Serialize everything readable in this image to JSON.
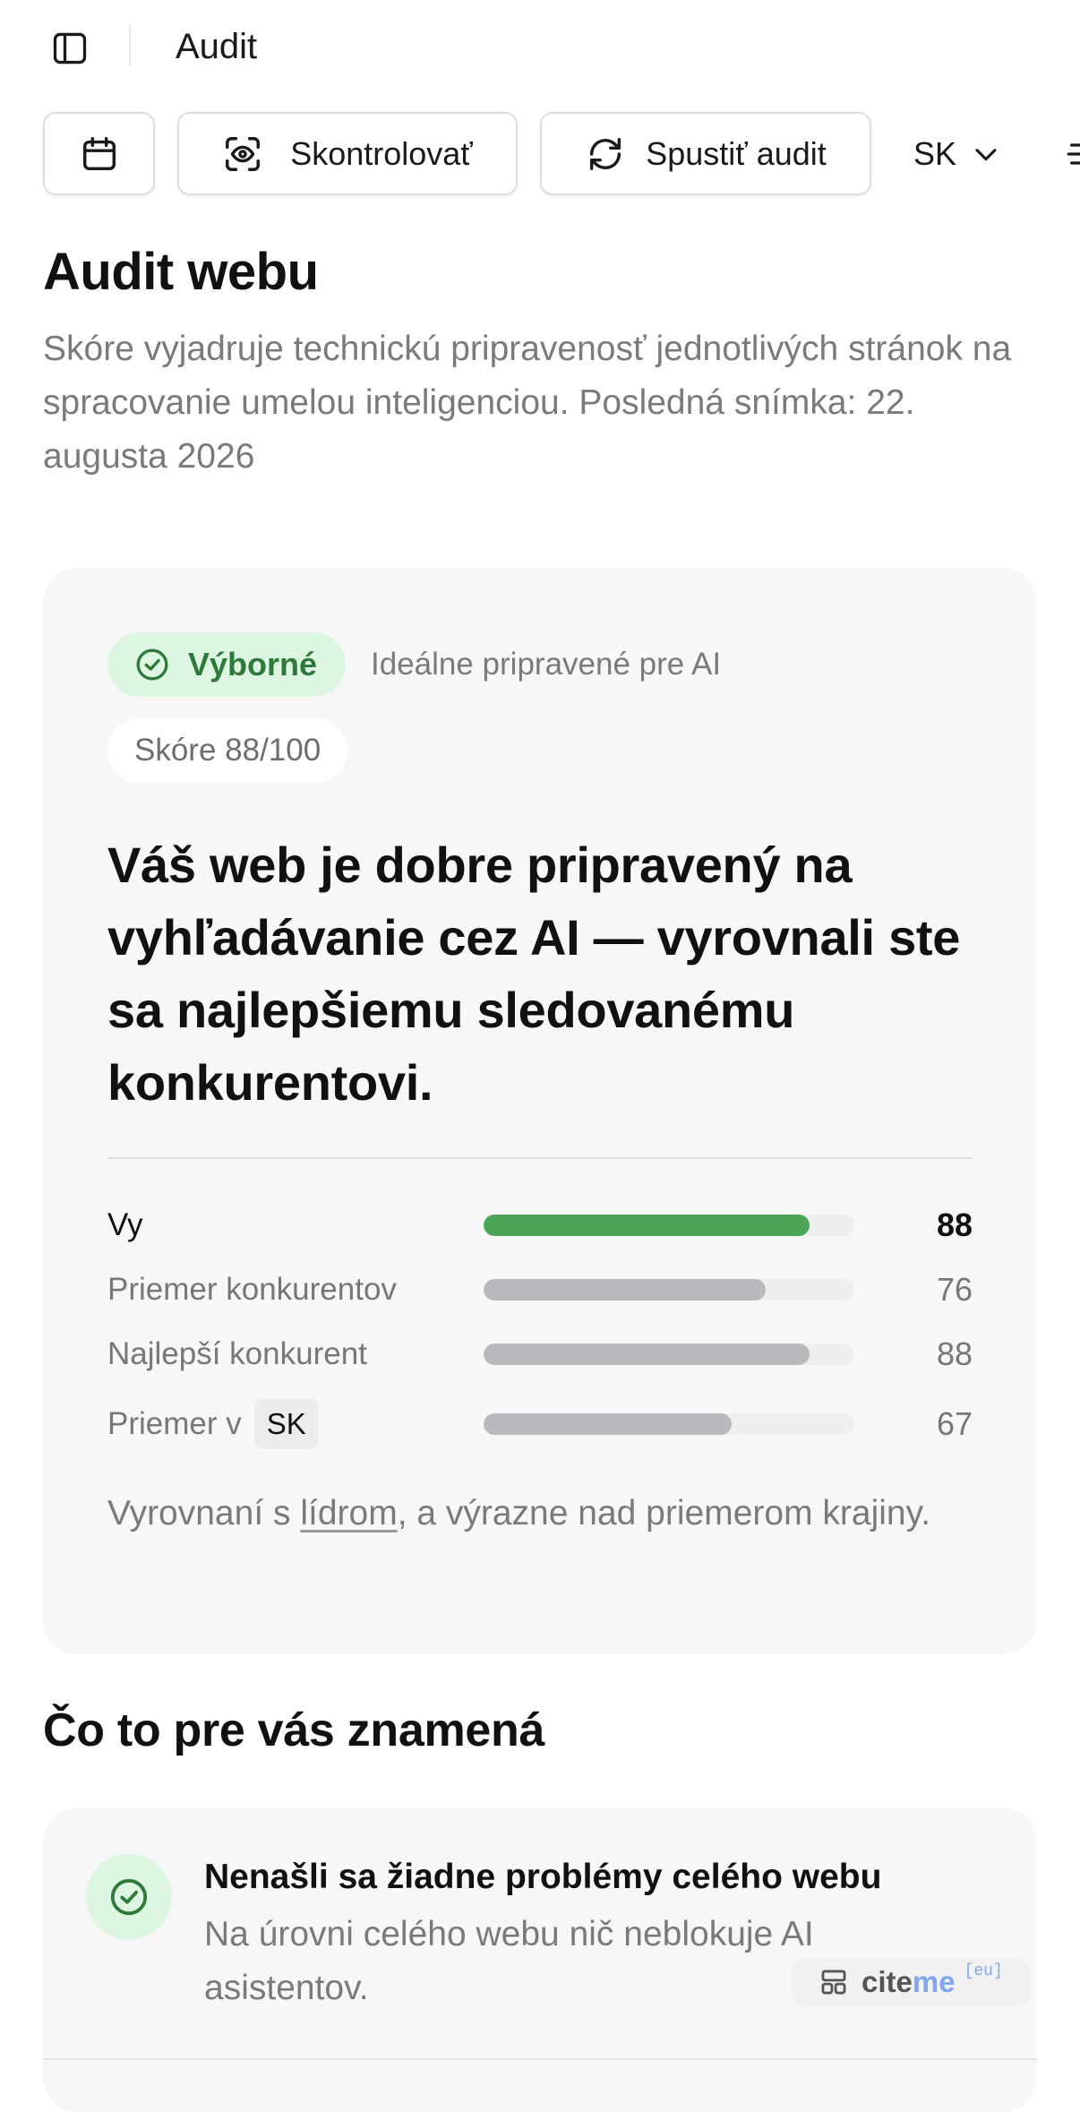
{
  "topbar": {
    "title": "Audit"
  },
  "toolbar": {
    "check_label": "Skontrolovať",
    "run_label": "Spustiť audit",
    "language": "SK"
  },
  "page": {
    "title": "Audit webu",
    "description": "Skóre vyjadruje technickú pripravenosť jednotlivých stránok na spracovanie umelou inteligenciou. Posledná snímka: 22. augusta 2026"
  },
  "score_card": {
    "status_label": "Výborné",
    "status_caption": "Ideálne pripravené pre AI",
    "score_pill": "Skóre 88/100",
    "headline": "Váš web je dobre pripravený na vyhľadávanie cez AI — vyrovnali ste sa najlepšiemu sledovanému konkurentovi.",
    "rows": [
      {
        "label": "Vy",
        "value": 88
      },
      {
        "label": "Priemer konkurentov",
        "value": 76
      },
      {
        "label": "Najlepší konkurent",
        "value": 88
      },
      {
        "label": "Priemer v",
        "chip": "SK",
        "value": 67
      }
    ],
    "summary_before": "Vyrovnaní s ",
    "summary_link": "lídrom",
    "summary_after": ", a výrazne nad priemerom krajiny."
  },
  "meaning": {
    "title": "Čo to pre vás znamená",
    "item_title": "Nenašli sa žiadne problémy celého webu",
    "item_text": "Na úrovni celého webu nič neblokuje AI asistentov."
  },
  "brand": {
    "part1": "cite",
    "part2": "me",
    "suffix": "[eu]"
  },
  "colors": {
    "accent_green": "#4ea456",
    "badge_green_bg": "#ddf6e2",
    "bar_gray": "#b9b9bd",
    "brand_blue": "#7fa6ee"
  },
  "icons": [
    "sidebar-toggle-icon",
    "calendar-icon",
    "scan-eye-icon",
    "refresh-icon",
    "chevron-down-icon",
    "check-circle-icon",
    "layout-icon"
  ]
}
